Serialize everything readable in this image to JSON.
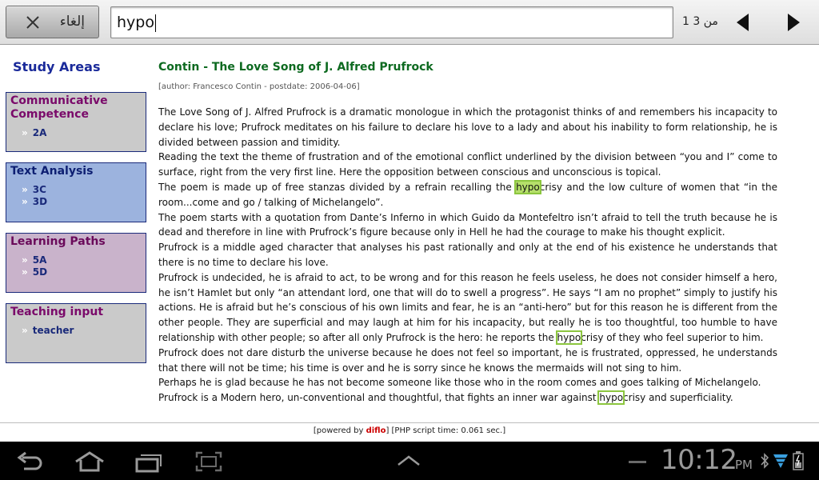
{
  "findbar": {
    "cancel_label": "إلغاء",
    "query": "hypo",
    "match_count": "1 من 3"
  },
  "sidebar": {
    "title": "Study Areas",
    "areas": [
      {
        "title": "Communicative Competence",
        "links": [
          "2A"
        ]
      },
      {
        "title": "Text Analysis",
        "links": [
          "3C",
          "3D"
        ]
      },
      {
        "title": "Learning Paths",
        "links": [
          "5A",
          "5D"
        ]
      },
      {
        "title": "Teaching input",
        "links": [
          "teacher"
        ]
      }
    ]
  },
  "article": {
    "title": "Contin - The Love Song of J. Alfred Prufrock",
    "meta": "[author: Francesco Contin - postdate: 2006-04-06]",
    "p1": "The Love Song of J. Alfred Prufrock is a dramatic monologue in which the protagonist thinks of and remembers his incapacity to declare his love; Prufrock meditates on his failure to declare his love to a lady and about his inability to form relationship, he is divided between passion and timidity.",
    "p2": "Reading the text the theme of frustration and of the emotional conflict underlined by the division between “you and I” come to surface, right from the very first line. Here the opposition between conscious and unconscious is topical.",
    "p3a": "The poem is made up of free stanzas divided by a refrain recalling the ",
    "p3hl": "hypo",
    "p3b": "crisy and the low culture of women that “in the room...come and go / talking of Michelangelo”.",
    "p4": "The poem starts with a quotation from Dante’s Inferno in which Guido da Montefeltro isn’t afraid to tell the truth because he is dead and therefore in line with Prufrock’s figure because only in Hell he had the courage to make his thought explicit.",
    "p5": "Prufrock is a middle aged character that analyses his past rationally and only at the end of his existence he understands that there is no time to declare his love.",
    "p6a": "Prufrock is undecided, he is afraid to act, to be wrong and for this reason he feels useless, he does not consider himself a hero, he isn’t Hamlet but only “an attendant lord, one that will do to swell a progress”. He says “I am no prophet” simply to justify his actions. He is afraid but he’s conscious of his own limits and fear, he is an “anti-hero” but for this reason he is different from the other people. They are superficial and may laugh at him for his incapacity, but really he is too thoughtful, too humble to have relationship with other people; so after all only Prufrock is the hero: he reports the ",
    "p6hl": "hypo",
    "p6b": "crisy of they who feel superior to him.",
    "p7": "Prufrock does not dare disturb the universe because he does not feel so important, he is frustrated, oppressed, he understands that there will not be time; his time is over and he is sorry since he knows the mermaids will not sing to him.",
    "p8": "Perhaps he is glad because he has not become someone like those who in the room comes and goes talking of Michelangelo.",
    "p9a": "Prufrock is a Modern hero, un-conventional and thoughtful, that fights an inner war against ",
    "p9hl": "hypo",
    "p9b": "crisy and superficiality."
  },
  "footer": {
    "prefix": "[powered by ",
    "brand": "diflo",
    "suffix": "] [PHP script time: 0.061 sec.]"
  },
  "statusbar": {
    "time": "10:12",
    "ampm": "PM"
  },
  "colors": {
    "highlight_border": "#8cc63f",
    "highlight_active": "#b5df6a",
    "article_title": "#0d6a20",
    "sidebar_title": "#1a2a9a"
  }
}
